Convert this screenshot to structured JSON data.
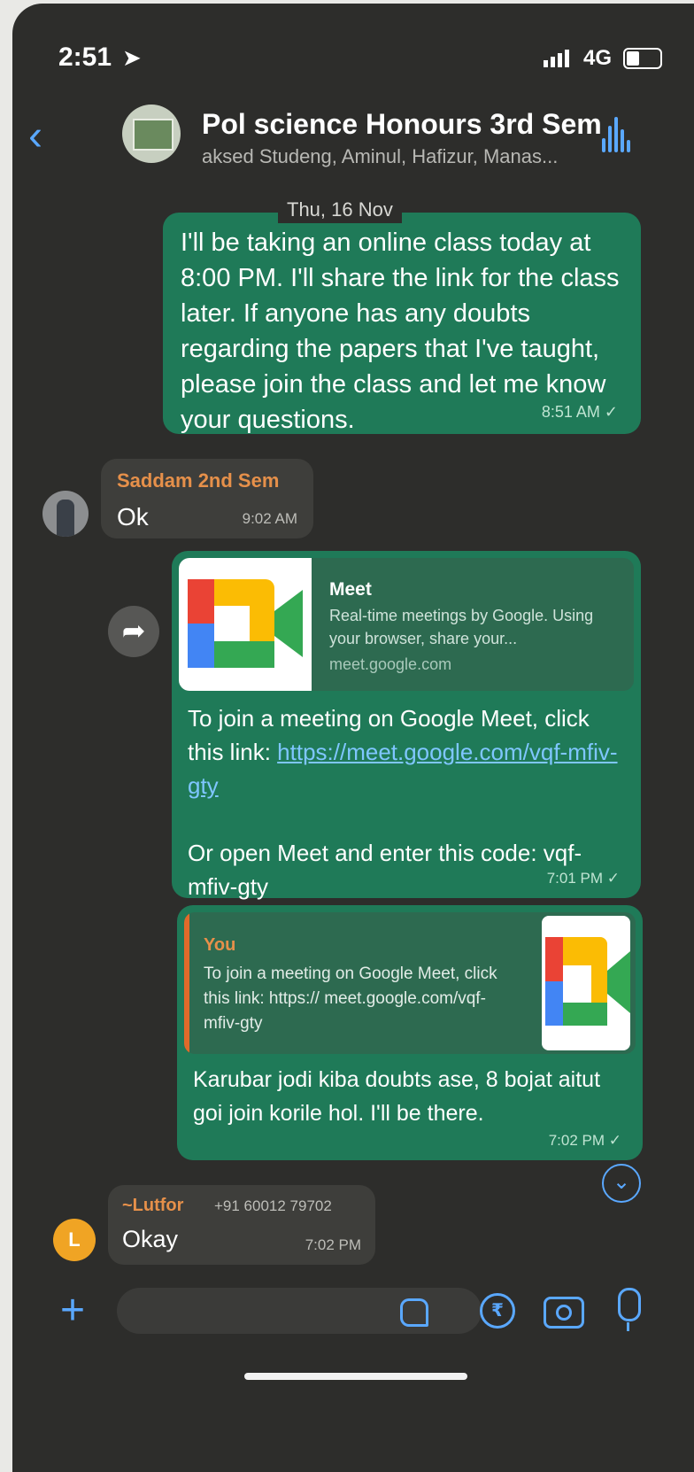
{
  "status_bar": {
    "time": "2:51",
    "network": "4G"
  },
  "header": {
    "title": "Pol science Honours 3rd Sem",
    "subtitle": "aksed Studeng, Aminul, Hafizur, Manas..."
  },
  "date_separator": "Thu, 16 Nov",
  "messages": [
    {
      "text": "I'll be taking an online class today at 8:00 PM. I'll share the link for the class later. If anyone has any doubts regarding the papers that I've taught, please join the class and let me know your questions.",
      "time": "8:51 AM"
    },
    {
      "sender": "Saddam 2nd Sem",
      "text": "Ok",
      "time": "9:02 AM"
    },
    {
      "preview": {
        "title": "Meet",
        "description": "Real-time meetings by Google. Using your browser, share your...",
        "domain": "meet.google.com"
      },
      "text_before_link": "To join a meeting on Google Meet, click this link: ",
      "link": "https://meet.google.com/vqf-mfiv-gty",
      "text_after_link": "Or open Meet and enter this code: vqf-mfiv-gty",
      "time": "7:01 PM"
    },
    {
      "quoted_sender": "You",
      "quoted_text": "To join a meeting on Google Meet, click this link: https:// meet.google.com/vqf-mfiv-gty",
      "text": "Karubar jodi kiba doubts ase, 8 bojat aitut goi join korile hol. I'll be there.",
      "time": "7:02 PM"
    },
    {
      "sender": "~Lutfor",
      "sender_phone": "+91 60012 79702",
      "avatar_letter": "L",
      "text": "Okay",
      "time": "7:02 PM"
    }
  ],
  "composer": {
    "placeholder": ""
  },
  "icons": {
    "back": "chevron-left-icon",
    "audio_call": "voice-wave-icon",
    "forward": "forward-icon",
    "scroll_down": "chevron-down-circle-icon",
    "attach": "plus-icon",
    "sticker": "sticker-icon",
    "payment": "rupee-icon",
    "camera": "camera-icon",
    "mic": "microphone-icon"
  },
  "colors": {
    "outgoing_bubble": "#1f7a58",
    "incoming_bubble": "#3e3e3b",
    "accent": "#5aa8ff",
    "sender_name": "#e6904a",
    "background": "#2d2d2b"
  }
}
